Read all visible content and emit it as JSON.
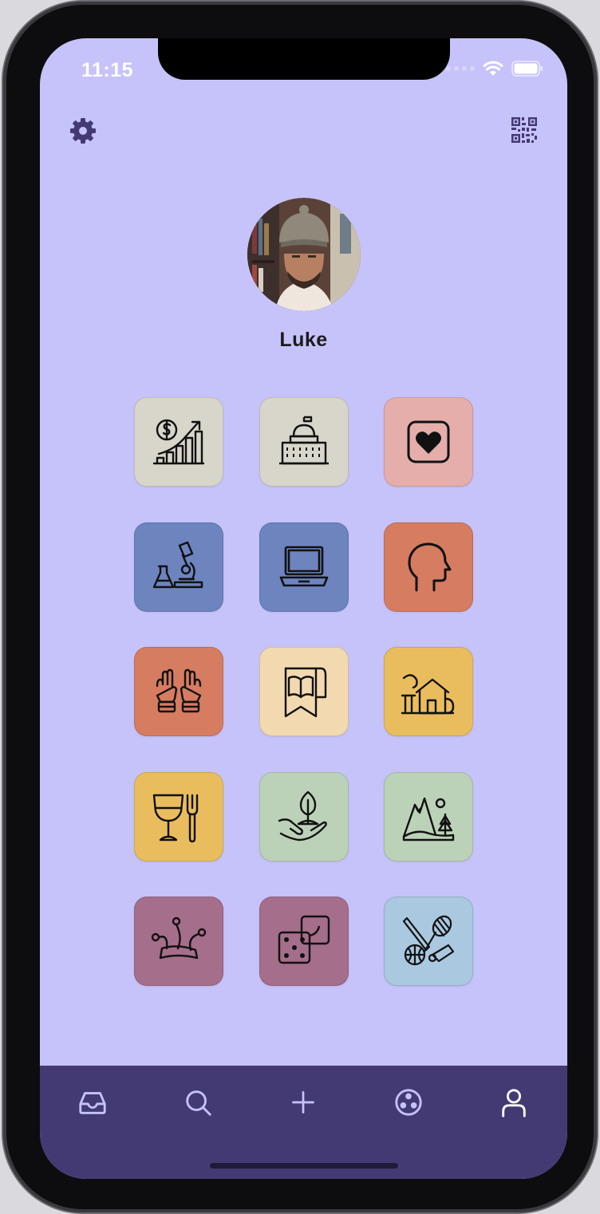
{
  "status_bar": {
    "time": "11:15"
  },
  "profile": {
    "name": "Luke"
  },
  "colors": {
    "background": "#c6c3fa",
    "tabbar": "#443a73",
    "icon_accent": "#443a73"
  },
  "categories": [
    {
      "icon": "finance-growth-icon",
      "color": "#d8d6cb"
    },
    {
      "icon": "government-building-icon",
      "color": "#d8d6cb"
    },
    {
      "icon": "heart-square-icon",
      "color": "#e5aeab"
    },
    {
      "icon": "science-microscope-icon",
      "color": "#6d84bf"
    },
    {
      "icon": "laptop-icon",
      "color": "#6d84bf"
    },
    {
      "icon": "head-profile-icon",
      "color": "#d67c60"
    },
    {
      "icon": "praying-hands-icon",
      "color": "#d67c60"
    },
    {
      "icon": "book-bookmark-icon",
      "color": "#f2d9b0"
    },
    {
      "icon": "home-tree-icon",
      "color": "#e9bd5e"
    },
    {
      "icon": "wine-fork-icon",
      "color": "#e9bd5e"
    },
    {
      "icon": "plant-hand-icon",
      "color": "#bcd2b8"
    },
    {
      "icon": "mountain-landscape-icon",
      "color": "#bcd2b8"
    },
    {
      "icon": "jester-hat-icon",
      "color": "#a56e8b"
    },
    {
      "icon": "dice-icon",
      "color": "#a56e8b"
    },
    {
      "icon": "sports-equipment-icon",
      "color": "#aac8df"
    }
  ],
  "tabbar": {
    "tabs": [
      {
        "icon": "inbox-icon"
      },
      {
        "icon": "search-icon"
      },
      {
        "icon": "plus-icon"
      },
      {
        "icon": "community-icon"
      },
      {
        "icon": "profile-icon",
        "active": true
      }
    ]
  }
}
